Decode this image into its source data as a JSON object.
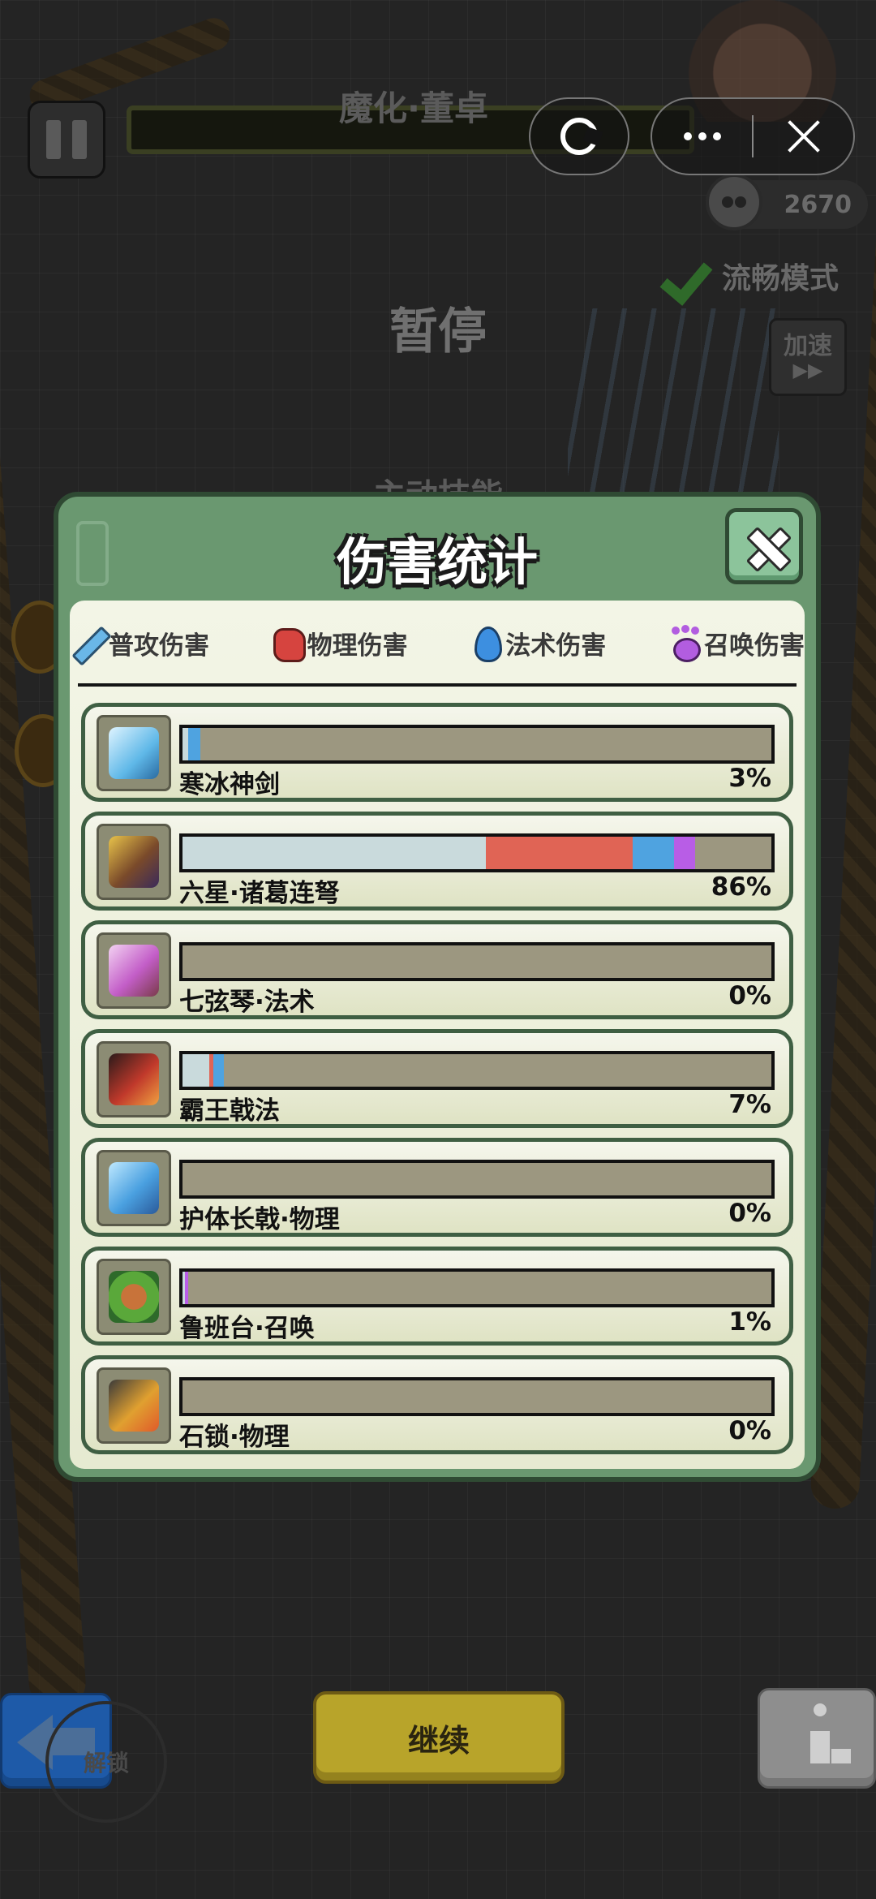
{
  "hud": {
    "boss_name": "魔化·董卓",
    "kill_count": "2670",
    "smooth_mode": "流畅模式",
    "speed_up": "加速",
    "speed_up_arrows": "▶▶",
    "paused": "暂停",
    "active_skill": "主动技能"
  },
  "modal": {
    "title": "伤害统计",
    "legend": [
      {
        "label": "普攻伤害",
        "icon": "sword-icon",
        "color": "#c9dadc"
      },
      {
        "label": "物理伤害",
        "icon": "fist-icon",
        "color": "#e06455"
      },
      {
        "label": "法术伤害",
        "icon": "flame-icon",
        "color": "#4fa3e0"
      },
      {
        "label": "召唤伤害",
        "icon": "paw-icon",
        "color": "#b85de6"
      }
    ],
    "rows": [
      {
        "name": "寒冰神剑",
        "pct": "3%",
        "icon": "ice-sword-icon",
        "segments": [
          {
            "type": "basic",
            "value": 1
          },
          {
            "type": "magic",
            "value": 2
          }
        ]
      },
      {
        "name": "六星·诸葛连弩",
        "pct": "86%",
        "icon": "crossbow-icon",
        "segments": [
          {
            "type": "basic",
            "value": 51.5
          },
          {
            "type": "physical",
            "value": 25
          },
          {
            "type": "magic",
            "value": 7
          },
          {
            "type": "summon",
            "value": 3.5
          }
        ]
      },
      {
        "name": "七弦琴·法术",
        "pct": "0%",
        "icon": "zither-icon",
        "segments": []
      },
      {
        "name": "霸王戟法",
        "pct": "7%",
        "icon": "halberd-icon",
        "segments": [
          {
            "type": "basic",
            "value": 4.5
          },
          {
            "type": "physical",
            "value": 0.8
          },
          {
            "type": "magic",
            "value": 1.7
          }
        ]
      },
      {
        "name": "护体长戟·物理",
        "pct": "0%",
        "icon": "guard-halberd-icon",
        "segments": []
      },
      {
        "name": "鲁班台·召唤",
        "pct": "1%",
        "icon": "luban-platform-icon",
        "segments": [
          {
            "type": "basic",
            "value": 0.4
          },
          {
            "type": "summon",
            "value": 0.6
          }
        ]
      },
      {
        "name": "石锁·物理",
        "pct": "0%",
        "icon": "stone-lock-icon",
        "segments": []
      }
    ]
  },
  "bottom": {
    "unlock_hint": "解锁",
    "continue": "继续"
  }
}
